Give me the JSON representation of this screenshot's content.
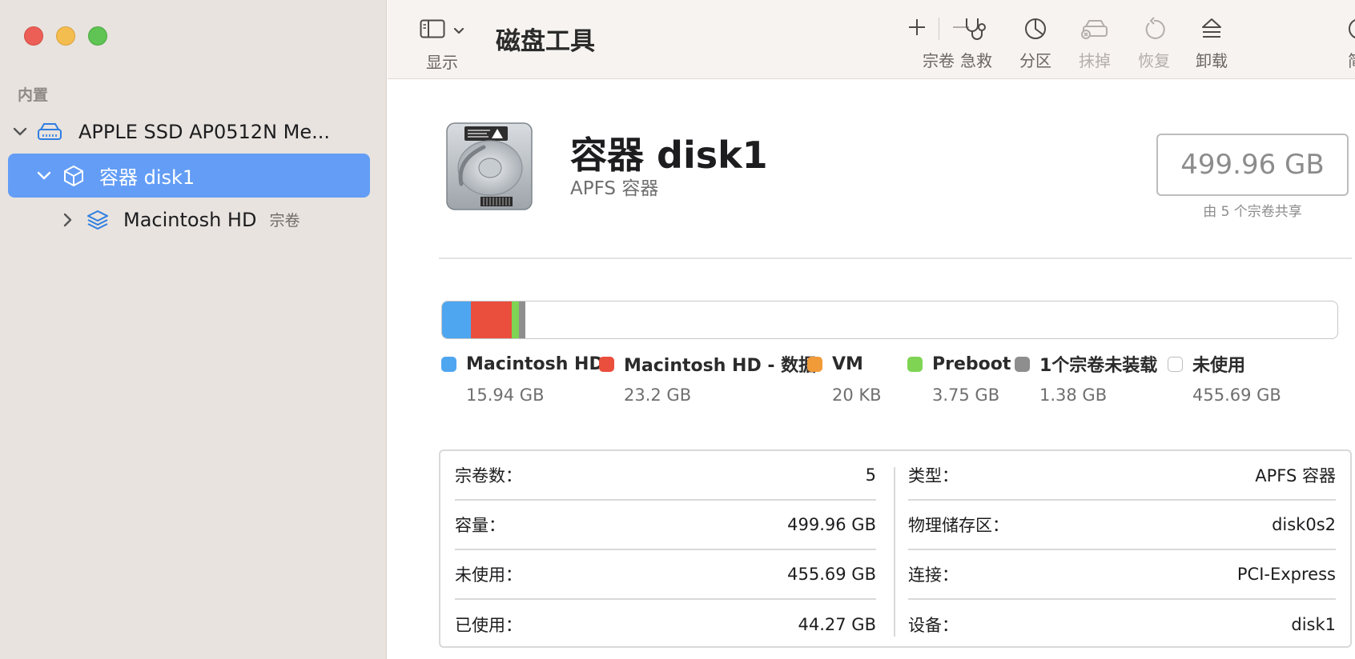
{
  "sidebar": {
    "section_label": "内置",
    "disk": {
      "label": "APPLE SSD AP0512N Me..."
    },
    "container": {
      "label": "容器 disk1"
    },
    "volume": {
      "label": "Macintosh HD",
      "sub": "宗卷"
    }
  },
  "toolbar": {
    "view_label": "显示",
    "title": "磁盘工具",
    "volume_label": "宗卷",
    "first_aid_label": "急救",
    "partition_label": "分区",
    "erase_label": "抹掉",
    "restore_label": "恢复",
    "unmount_label": "卸载",
    "info_label": "简"
  },
  "header": {
    "name": "容器 disk1",
    "subtitle": "APFS 容器",
    "capacity": "499.96 GB",
    "shared_note": "由 5 个宗卷共享"
  },
  "usage": {
    "segments": [
      {
        "name": "Macintosh HD",
        "value": "15.94 GB",
        "color": "#4fa6f0",
        "fraction": 0.0319
      },
      {
        "name": "Macintosh HD - 数据",
        "value": "23.2 GB",
        "color": "#ea4e3d",
        "fraction": 0.0464
      },
      {
        "name": "VM",
        "value": "20 KB",
        "color": "#f19a38",
        "fraction": 0.0
      },
      {
        "name": "Preboot",
        "value": "3.75 GB",
        "color": "#7fd454",
        "fraction": 0.0075
      },
      {
        "name": "1个宗卷未装载",
        "value": "1.38 GB",
        "color": "#8e8e8e",
        "fraction": 0.0028
      },
      {
        "name": "未使用",
        "value": "455.69 GB",
        "color": "#ffffff",
        "fraction": 0.9114
      }
    ]
  },
  "info": {
    "left": [
      {
        "key": "宗卷数：",
        "value": "5"
      },
      {
        "key": "容量：",
        "value": "499.96 GB"
      },
      {
        "key": "未使用：",
        "value": "455.69 GB"
      },
      {
        "key": "已使用：",
        "value": "44.27 GB"
      }
    ],
    "right": [
      {
        "key": "类型：",
        "value": "APFS 容器"
      },
      {
        "key": "物理储存区：",
        "value": "disk0s2"
      },
      {
        "key": "连接：",
        "value": "PCI-Express"
      },
      {
        "key": "设备：",
        "value": "disk1"
      }
    ]
  }
}
